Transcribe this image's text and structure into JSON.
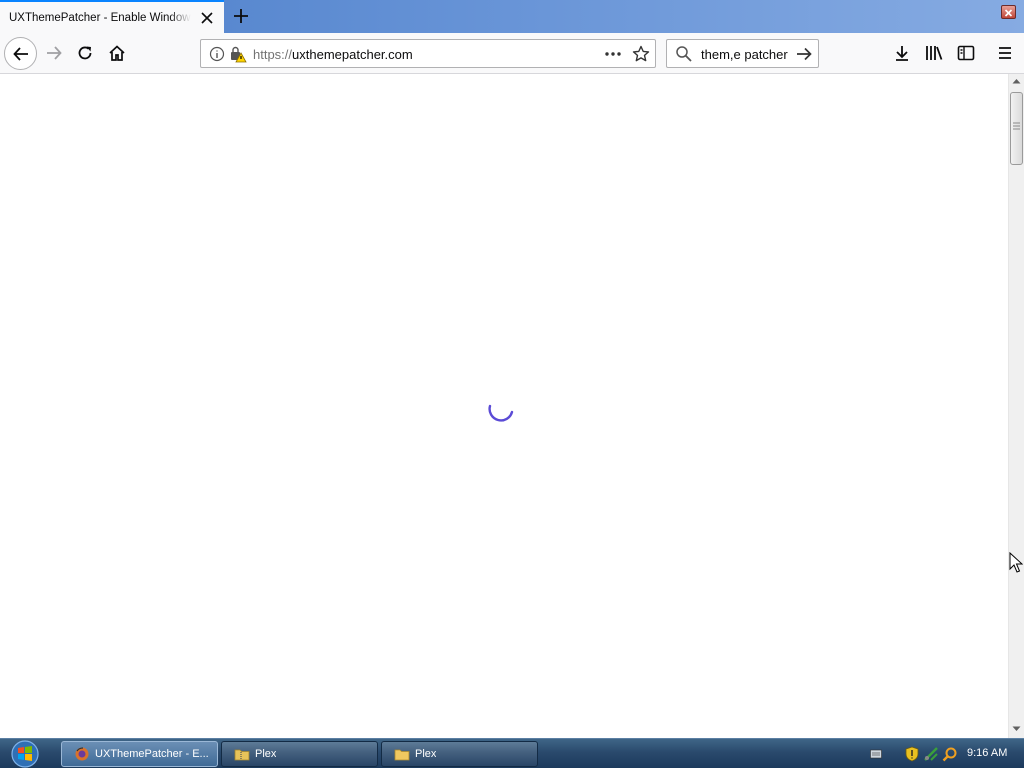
{
  "browser": {
    "tab_title": "UXThemePatcher - Enable Windows Themes",
    "url_scheme": "https://",
    "url_host": "uxthemepatcher.com",
    "search_text": "them,e patcher"
  },
  "page": {
    "state": "loading"
  },
  "taskbar": {
    "tasks": [
      {
        "label": "UXThemePatcher - E...",
        "icon": "firefox-icon",
        "active": true
      },
      {
        "label": "Plex",
        "icon": "zip-folder-icon",
        "active": false
      },
      {
        "label": "Plex",
        "icon": "folder-icon",
        "active": false
      }
    ],
    "clock": "9:16 AM"
  },
  "colors": {
    "accent": "#0a84ff",
    "spinner": "#5b4bd6",
    "taskbar": "#2a4a6d"
  }
}
